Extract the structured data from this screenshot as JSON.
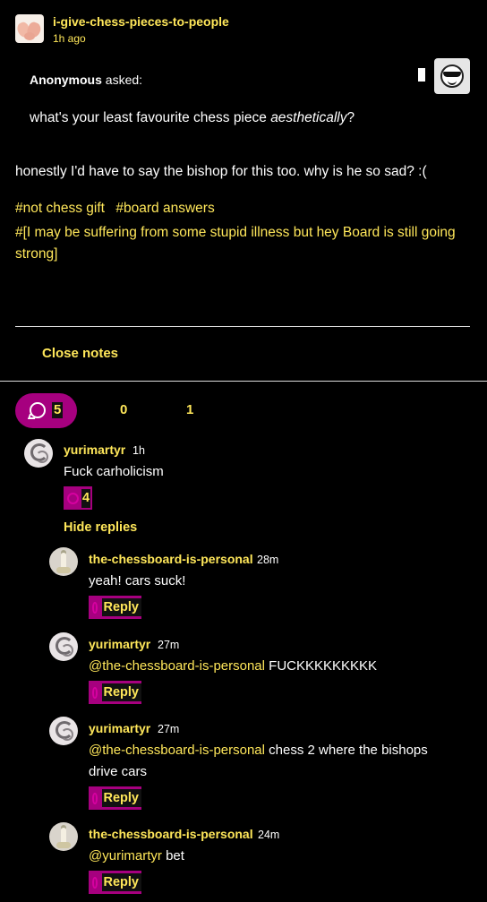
{
  "post": {
    "blog_name": "i-give-chess-pieces-to-people",
    "time": "1h ago",
    "asker": "Anonymous",
    "asked_suffix": " asked:",
    "question_start": "what's your least favourite chess piece ",
    "question_emph": "aesthetically",
    "question_end": "?",
    "answer": "honestly I'd have to say the bishop for this too. why is he so sad? :(",
    "tags": [
      "#not chess gift",
      "#board answers"
    ],
    "long_tag": "#[I may be suffering from some stupid illness but hey Board is still going strong]",
    "close_notes_label": "Close notes"
  },
  "tabs": {
    "replies_count": "5",
    "reblogs_count": "0",
    "likes_count": "1"
  },
  "comments": [
    {
      "name": "yurimartyr",
      "time": "1h",
      "text": "Fuck carholicism",
      "reply_count": "4",
      "hide_label": "Hide replies"
    },
    {
      "name": "the-chessboard-is-personal",
      "time": "28m",
      "text": "yeah! cars suck!",
      "reply_label": "Reply"
    },
    {
      "name": "yurimartyr",
      "time": "27m",
      "mention": "@the-chessboard-is-personal",
      "text": " FUCKKKKKKKKK",
      "reply_label": "Reply"
    },
    {
      "name": "yurimartyr",
      "time": "27m",
      "mention": "@the-chessboard-is-personal",
      "text": " chess 2 where the bishops drive cars",
      "reply_label": "Reply"
    },
    {
      "name": "the-chessboard-is-personal",
      "time": "24m",
      "mention": "@yurimartyr",
      "text": " bet",
      "reply_label": "Reply"
    }
  ],
  "colors": {
    "accent": "#a6007f",
    "text_accent": "#ffe75a",
    "background": "#000000"
  }
}
